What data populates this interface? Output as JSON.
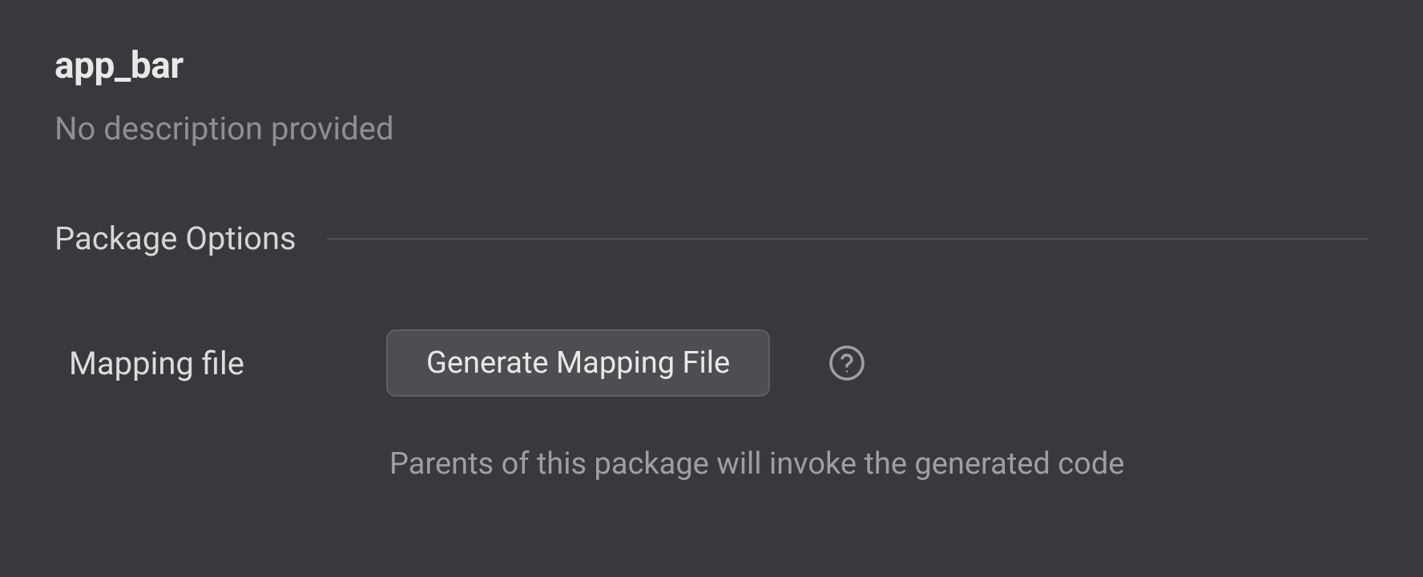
{
  "header": {
    "title": "app_bar",
    "description": "No description provided"
  },
  "section": {
    "title": "Package Options"
  },
  "options": {
    "mapping_file": {
      "label": "Mapping file",
      "button_label": "Generate Mapping File",
      "help_text": "Parents of this package will invoke the generated code"
    }
  }
}
